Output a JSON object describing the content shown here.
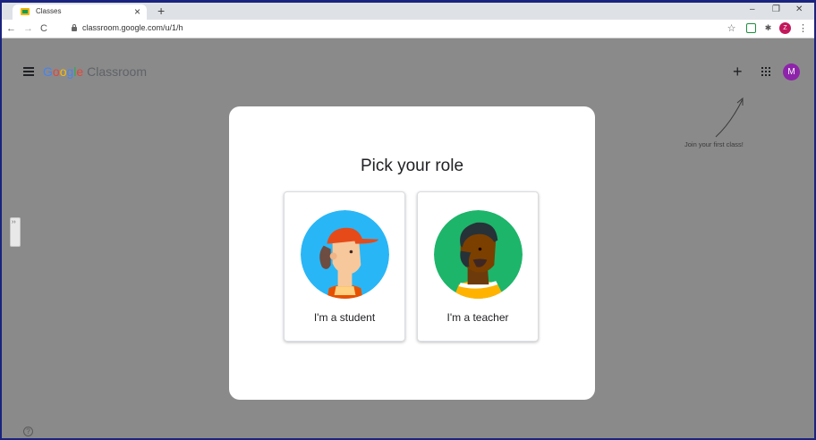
{
  "browser": {
    "tab_title": "Classes",
    "tab_close": "×",
    "new_tab": "+",
    "url": "classroom.google.com/u/1/h",
    "window_controls": [
      "–",
      "❐",
      "✕"
    ],
    "nav": {
      "back": "←",
      "forward": "→",
      "reload": "C"
    },
    "extensions": {
      "star": "☆",
      "puzzle": "✱",
      "profile": "Z",
      "menu": "⋮"
    }
  },
  "app": {
    "logo_word1": [
      "G",
      "o",
      "o",
      "g",
      "l",
      "e"
    ],
    "logo_word2": "Classroom",
    "plus": "+",
    "avatar_letter": "M",
    "join_hint": "Join your first class!",
    "help": "?"
  },
  "dialog": {
    "title": "Pick your role",
    "roles": [
      {
        "label": "I'm a student"
      },
      {
        "label": "I'm a teacher"
      }
    ]
  },
  "colors": {
    "background": "#8a8a8a",
    "accent_purple": "#8e24aa",
    "student_circle": "#29b6f6",
    "teacher_circle": "#1db56a"
  }
}
